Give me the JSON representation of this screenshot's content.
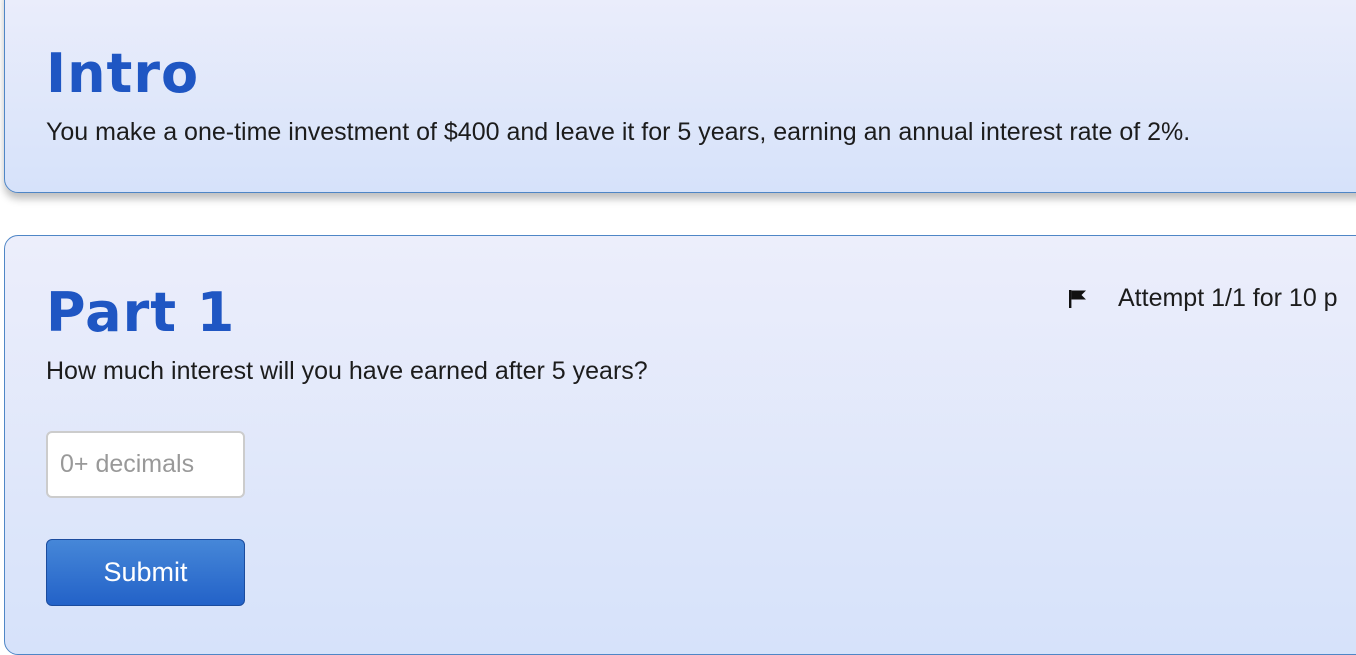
{
  "intro": {
    "title": "Intro",
    "text": "You make a one-time investment of $400 and leave it for 5 years, earning an annual interest rate of 2%."
  },
  "part1": {
    "title": "Part 1",
    "question": "How much interest will you have earned after 5 years?",
    "attempt_label": "Attempt 1/1 for 10 p",
    "flag_icon": "flag-icon",
    "answer_input": {
      "placeholder": "0+ decimals",
      "value": ""
    },
    "submit_label": "Submit"
  }
}
